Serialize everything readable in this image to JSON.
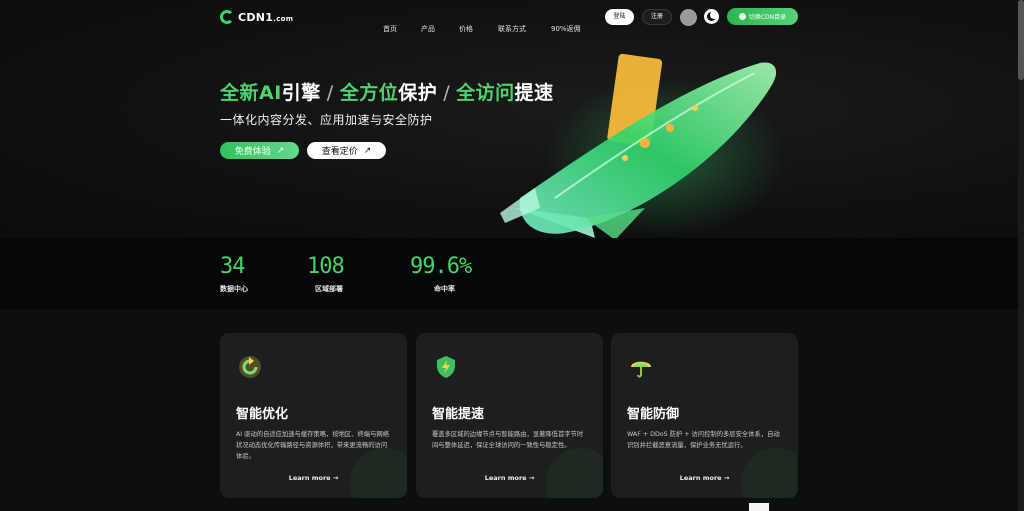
{
  "header": {
    "logo_main": "CDN1",
    "logo_suffix": ".com",
    "nav": [
      "首页",
      "产品",
      "价格",
      "联系方式",
      "90%返佣"
    ],
    "login_label": "登陆",
    "register_label": "注册",
    "switch_label": "切换CDN目录"
  },
  "hero": {
    "headline": [
      {
        "text": "全新AI",
        "green": true
      },
      {
        "text": "引擎",
        "green": false
      },
      {
        "text": "全方位",
        "green": true
      },
      {
        "text": "保护",
        "green": false
      },
      {
        "text": "全访问",
        "green": true
      },
      {
        "text": "提速",
        "green": false
      }
    ],
    "headline_separator": "/",
    "subtitle": "一体化内容分发、应用加速与安全防护",
    "trial_button": "免费体验",
    "price_button": "查看定价",
    "button_arrow": "↗"
  },
  "stats": [
    {
      "value": "34",
      "label": "数据中心"
    },
    {
      "value": "108",
      "label": "区域部署"
    },
    {
      "value": "99.6%",
      "label": "命中率"
    }
  ],
  "features": [
    {
      "icon": "refresh-icon",
      "title": "智能优化",
      "desc": "AI 驱动的自适应加速与缓存策略，按地区、终端与网络状况动态优化传输路径与资源体积，带来更流畅的访问体验。",
      "link": "Learn more →"
    },
    {
      "icon": "shield-bolt-icon",
      "title": "智能提速",
      "desc": "覆盖多区域的边缘节点与智能路由，显著降低首字节时间与整体延迟，保证全球访问的一致性与稳定性。",
      "link": "Learn more →"
    },
    {
      "icon": "umbrella-icon",
      "title": "智能防御",
      "desc": "WAF + DDoS 防护 + 访问控制的多层安全体系，自动识别并拦截恶意流量，保护业务无忧运行。",
      "link": "Learn more →"
    }
  ],
  "colors": {
    "accent": "#47d36a",
    "background": "#0d0e0e",
    "card": "#1d1f1f"
  }
}
